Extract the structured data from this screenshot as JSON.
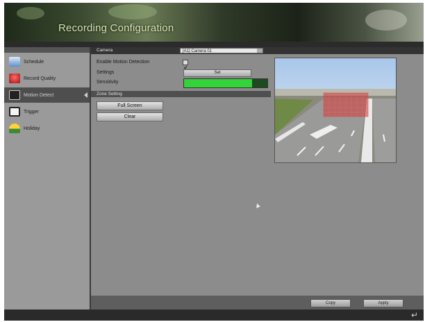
{
  "window": {
    "title": "Recording Configuration"
  },
  "sidebar": {
    "items": [
      {
        "label": "Schedule",
        "icon": "calendar-icon",
        "active": false
      },
      {
        "label": "Record Quality",
        "icon": "record-quality-icon",
        "active": false
      },
      {
        "label": "Motion Detect",
        "icon": "motion-camera-icon",
        "active": true
      },
      {
        "label": "Trigger",
        "icon": "trigger-icon",
        "active": false
      },
      {
        "label": "Holiday",
        "icon": "holiday-umbrella-icon",
        "active": false
      }
    ]
  },
  "main": {
    "camera_label": "Camera",
    "camera_value": "[A1] Camera 01",
    "enable_label": "Enable Motion Detection",
    "enable_checked": true,
    "settings_label": "Settings",
    "set_button": "Set",
    "sensitivity_label": "Sensitivity",
    "sensitivity_level": 0.82,
    "zone_header": "Zone Setting",
    "fullscreen_button": "Full Screen",
    "clear_button": "Clear"
  },
  "footer": {
    "copy_button": "Copy",
    "apply_button": "Apply"
  },
  "colors": {
    "accent_green": "#33d43a",
    "zone_red": "#d23a3a",
    "active_item": "#4e4e4e"
  }
}
